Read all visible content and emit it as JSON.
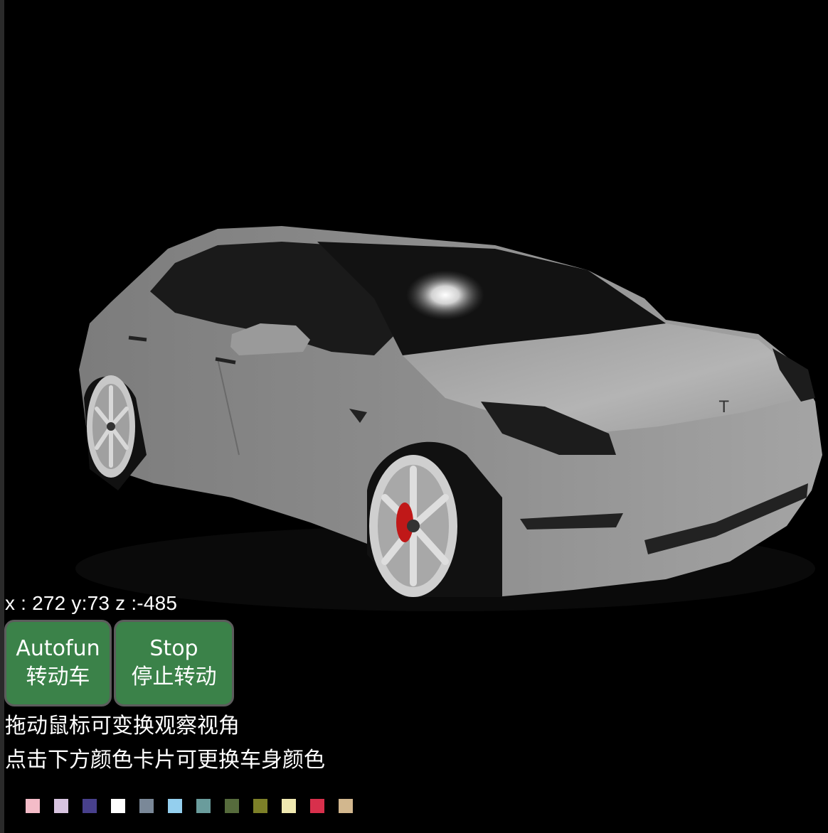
{
  "viewer": {
    "scene": "3d-car-model",
    "coords_text": "x : 272 y:73 z :-485"
  },
  "buttons": {
    "autofun": {
      "line1": "Autofun",
      "line2": "转动车"
    },
    "stop": {
      "line1": "Stop",
      "line2": "停止转动"
    }
  },
  "hints": {
    "drag": "拖动鼠标可变换观察视角",
    "color": "点击下方颜色卡片可更换车身颜色"
  },
  "colors": {
    "background": "#000000",
    "button_bg": "#3b8249",
    "button_border": "#5c5c5c",
    "car_body": "#8a8a8a"
  },
  "swatches": [
    {
      "color": "#f4bcc8",
      "name": "pink"
    },
    {
      "color": "#d8c4e0",
      "name": "lilac"
    },
    {
      "color": "#48408c",
      "name": "indigo"
    },
    {
      "color": "#ffffff",
      "name": "white"
    },
    {
      "color": "#7a8898",
      "name": "slate-gray"
    },
    {
      "color": "#94cfee",
      "name": "sky-blue"
    },
    {
      "color": "#6a9c9c",
      "name": "teal-gray"
    },
    {
      "color": "#566b3c",
      "name": "olive-green"
    },
    {
      "color": "#7d8028",
      "name": "olive"
    },
    {
      "color": "#efe8b0",
      "name": "cream"
    },
    {
      "color": "#d8304c",
      "name": "crimson"
    },
    {
      "color": "#d2b78e",
      "name": "tan"
    }
  ]
}
